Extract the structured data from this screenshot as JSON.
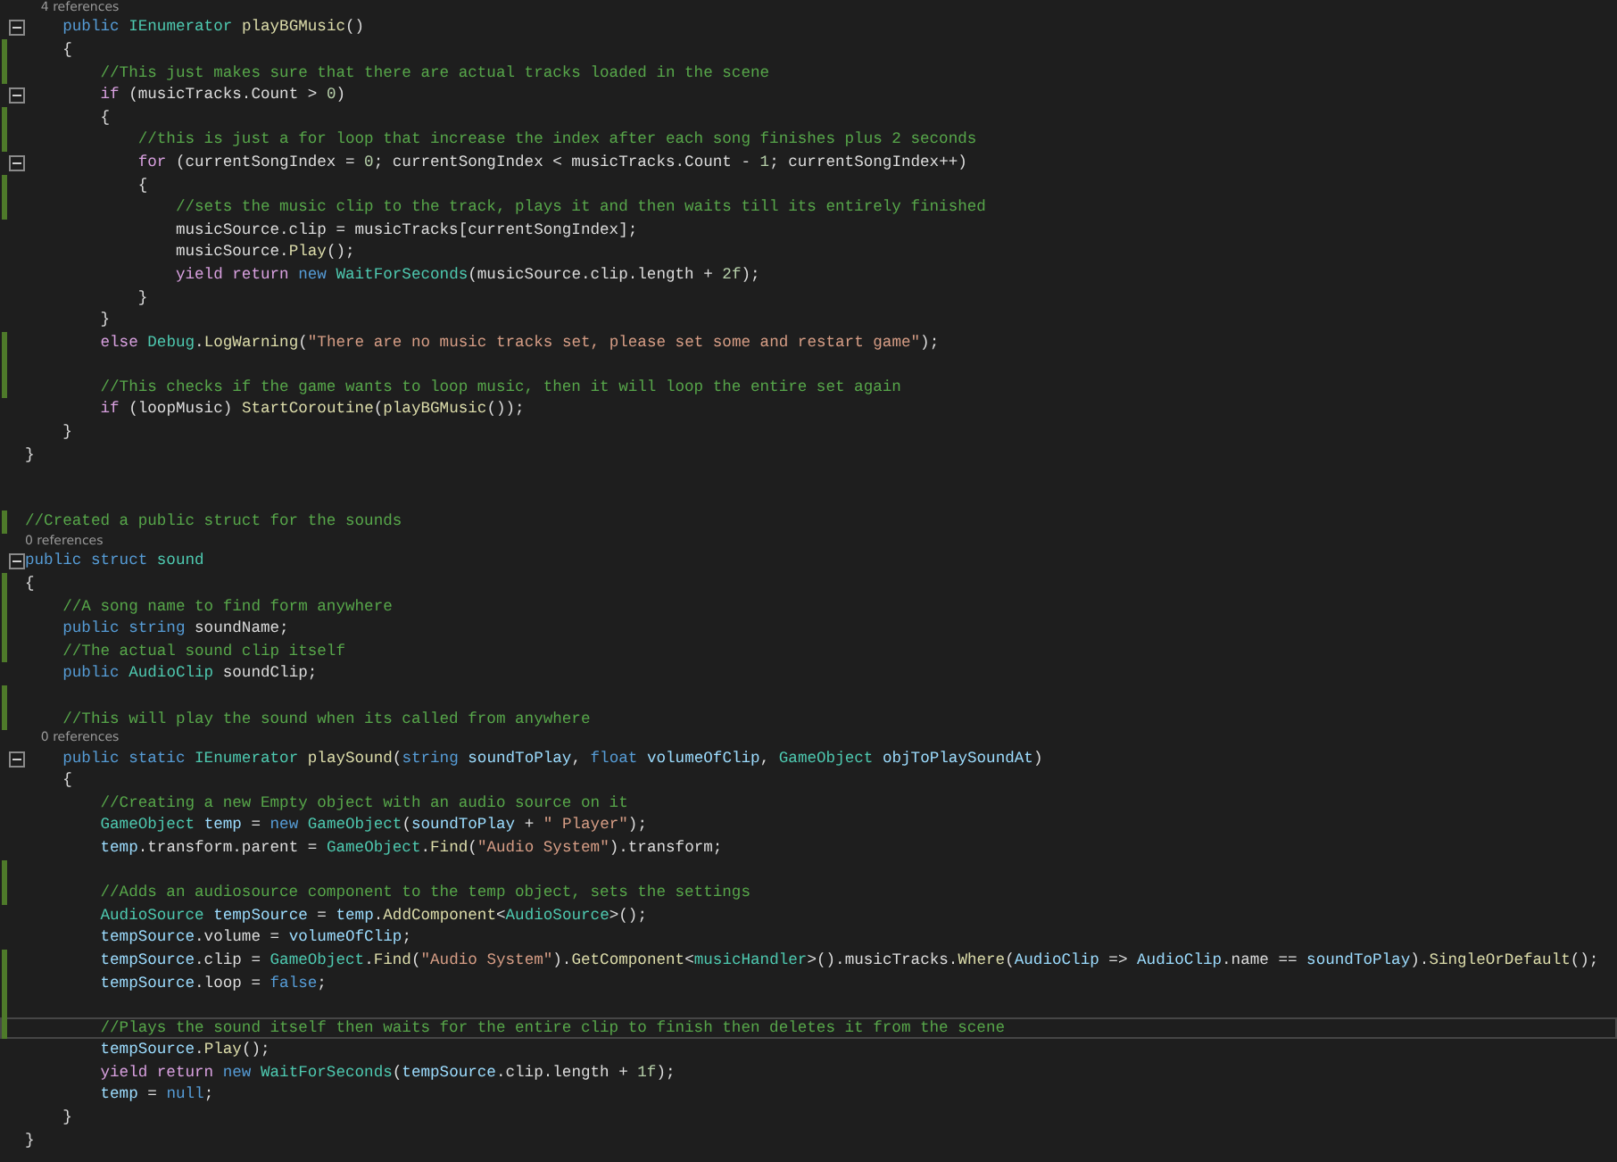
{
  "editor": {
    "lines": [
      {
        "kind": "lens",
        "text": "    4 references"
      },
      {
        "kind": "code",
        "changed": false,
        "fold": true,
        "current": false,
        "tokens": [
          {
            "kind": "kw",
            "text": "    public "
          },
          {
            "kind": "type",
            "text": "IEnumerator "
          },
          {
            "kind": "method",
            "text": "playBGMusic"
          },
          {
            "kind": "plain",
            "text": "()"
          }
        ]
      },
      {
        "kind": "code",
        "changed": true,
        "fold": false,
        "current": false,
        "tokens": [
          {
            "kind": "plain",
            "text": "    {"
          }
        ]
      },
      {
        "kind": "code",
        "changed": true,
        "fold": false,
        "current": false,
        "tokens": [
          {
            "kind": "comment",
            "text": "        //This just makes sure that there are actual tracks loaded in the scene"
          }
        ]
      },
      {
        "kind": "code",
        "changed": false,
        "fold": true,
        "current": false,
        "tokens": [
          {
            "kind": "ctrl",
            "text": "        if"
          },
          {
            "kind": "plain",
            "text": " (musicTracks.Count > "
          },
          {
            "kind": "num",
            "text": "0"
          },
          {
            "kind": "plain",
            "text": ")"
          }
        ]
      },
      {
        "kind": "code",
        "changed": true,
        "fold": false,
        "current": false,
        "tokens": [
          {
            "kind": "plain",
            "text": "        {"
          }
        ]
      },
      {
        "kind": "code",
        "changed": true,
        "fold": false,
        "current": false,
        "tokens": [
          {
            "kind": "comment",
            "text": "            //this is just a for loop that increase the index after each song finishes plus 2 seconds"
          }
        ]
      },
      {
        "kind": "code",
        "changed": false,
        "fold": true,
        "current": false,
        "tokens": [
          {
            "kind": "ctrl",
            "text": "            for"
          },
          {
            "kind": "plain",
            "text": " (currentSongIndex = "
          },
          {
            "kind": "num",
            "text": "0"
          },
          {
            "kind": "plain",
            "text": "; currentSongIndex < musicTracks.Count - "
          },
          {
            "kind": "num",
            "text": "1"
          },
          {
            "kind": "plain",
            "text": "; currentSongIndex++)"
          }
        ]
      },
      {
        "kind": "code",
        "changed": true,
        "fold": false,
        "current": false,
        "tokens": [
          {
            "kind": "plain",
            "text": "            {"
          }
        ]
      },
      {
        "kind": "code",
        "changed": true,
        "fold": false,
        "current": false,
        "tokens": [
          {
            "kind": "comment",
            "text": "                //sets the music clip to the track, plays it and then waits till its entirely finished"
          }
        ]
      },
      {
        "kind": "code",
        "changed": false,
        "fold": false,
        "current": false,
        "tokens": [
          {
            "kind": "plain",
            "text": "                musicSource.clip = musicTracks[currentSongIndex];"
          }
        ]
      },
      {
        "kind": "code",
        "changed": false,
        "fold": false,
        "current": false,
        "tokens": [
          {
            "kind": "plain",
            "text": "                musicSource."
          },
          {
            "kind": "method",
            "text": "Play"
          },
          {
            "kind": "plain",
            "text": "();"
          }
        ]
      },
      {
        "kind": "code",
        "changed": false,
        "fold": false,
        "current": false,
        "tokens": [
          {
            "kind": "ctrl",
            "text": "                yield return "
          },
          {
            "kind": "kw",
            "text": "new "
          },
          {
            "kind": "type",
            "text": "WaitForSeconds"
          },
          {
            "kind": "plain",
            "text": "(musicSource.clip.length + "
          },
          {
            "kind": "num",
            "text": "2f"
          },
          {
            "kind": "plain",
            "text": ");"
          }
        ]
      },
      {
        "kind": "code",
        "changed": false,
        "fold": false,
        "current": false,
        "tokens": [
          {
            "kind": "plain",
            "text": "            }"
          }
        ]
      },
      {
        "kind": "code",
        "changed": false,
        "fold": false,
        "current": false,
        "tokens": [
          {
            "kind": "plain",
            "text": "        }"
          }
        ]
      },
      {
        "kind": "code",
        "changed": true,
        "fold": false,
        "current": false,
        "tokens": [
          {
            "kind": "ctrl",
            "text": "        else "
          },
          {
            "kind": "type",
            "text": "Debug"
          },
          {
            "kind": "plain",
            "text": "."
          },
          {
            "kind": "method",
            "text": "LogWarning"
          },
          {
            "kind": "plain",
            "text": "("
          },
          {
            "kind": "string",
            "text": "\"There are no music tracks set, please set some and restart game\""
          },
          {
            "kind": "plain",
            "text": ");"
          }
        ]
      },
      {
        "kind": "code",
        "changed": true,
        "fold": false,
        "current": false
      },
      {
        "kind": "code",
        "changed": true,
        "fold": false,
        "current": false,
        "tokens": [
          {
            "kind": "comment",
            "text": "        //This checks if the game wants to loop music, then it will loop the entire set again"
          }
        ]
      },
      {
        "kind": "code",
        "changed": false,
        "fold": false,
        "current": false,
        "tokens": [
          {
            "kind": "ctrl",
            "text": "        if"
          },
          {
            "kind": "plain",
            "text": " (loopMusic) "
          },
          {
            "kind": "method",
            "text": "StartCoroutine"
          },
          {
            "kind": "plain",
            "text": "("
          },
          {
            "kind": "method",
            "text": "playBGMusic"
          },
          {
            "kind": "plain",
            "text": "());"
          }
        ]
      },
      {
        "kind": "code",
        "changed": false,
        "fold": false,
        "current": false,
        "tokens": [
          {
            "kind": "plain",
            "text": "    }"
          }
        ]
      },
      {
        "kind": "code",
        "changed": false,
        "fold": false,
        "current": false,
        "tokens": [
          {
            "kind": "plain",
            "text": "}"
          }
        ]
      },
      {
        "kind": "code",
        "changed": false,
        "fold": false,
        "current": false
      },
      {
        "kind": "code",
        "changed": false,
        "fold": false,
        "current": false
      },
      {
        "kind": "code",
        "changed": true,
        "fold": false,
        "current": false,
        "tokens": [
          {
            "kind": "comment",
            "text": "//Created a public struct for the sounds"
          }
        ]
      },
      {
        "kind": "lens",
        "text": "0 references"
      },
      {
        "kind": "code",
        "changed": false,
        "fold": true,
        "current": false,
        "tokens": [
          {
            "kind": "kw",
            "text": "public struct "
          },
          {
            "kind": "type",
            "text": "sound"
          }
        ]
      },
      {
        "kind": "code",
        "changed": true,
        "fold": false,
        "current": false,
        "tokens": [
          {
            "kind": "plain",
            "text": "{"
          }
        ]
      },
      {
        "kind": "code",
        "changed": true,
        "fold": false,
        "current": false,
        "tokens": [
          {
            "kind": "comment",
            "text": "    //A song name to find form anywhere"
          }
        ]
      },
      {
        "kind": "code",
        "changed": true,
        "fold": false,
        "current": false,
        "tokens": [
          {
            "kind": "kw",
            "text": "    public string "
          },
          {
            "kind": "plain",
            "text": "soundName;"
          }
        ]
      },
      {
        "kind": "code",
        "changed": true,
        "fold": false,
        "current": false,
        "tokens": [
          {
            "kind": "comment",
            "text": "    //The actual sound clip itself"
          }
        ]
      },
      {
        "kind": "code",
        "changed": false,
        "fold": false,
        "current": false,
        "tokens": [
          {
            "kind": "kw",
            "text": "    public "
          },
          {
            "kind": "type",
            "text": "AudioClip "
          },
          {
            "kind": "plain",
            "text": "soundClip;"
          }
        ]
      },
      {
        "kind": "code",
        "changed": true,
        "fold": false,
        "current": false
      },
      {
        "kind": "code",
        "changed": true,
        "fold": false,
        "current": false,
        "tokens": [
          {
            "kind": "comment",
            "text": "    //This will play the sound when its called from anywhere"
          }
        ]
      },
      {
        "kind": "lens",
        "text": "    0 references"
      },
      {
        "kind": "code",
        "changed": false,
        "fold": true,
        "current": false,
        "tokens": [
          {
            "kind": "kw",
            "text": "    public static "
          },
          {
            "kind": "type",
            "text": "IEnumerator "
          },
          {
            "kind": "method",
            "text": "playSound"
          },
          {
            "kind": "plain",
            "text": "("
          },
          {
            "kind": "kw",
            "text": "string "
          },
          {
            "kind": "var",
            "text": "soundToPlay"
          },
          {
            "kind": "plain",
            "text": ", "
          },
          {
            "kind": "kw",
            "text": "float "
          },
          {
            "kind": "var",
            "text": "volumeOfClip"
          },
          {
            "kind": "plain",
            "text": ", "
          },
          {
            "kind": "type",
            "text": "GameObject "
          },
          {
            "kind": "var",
            "text": "objToPlaySoundAt"
          },
          {
            "kind": "plain",
            "text": ")"
          }
        ]
      },
      {
        "kind": "code",
        "changed": false,
        "fold": false,
        "current": false,
        "tokens": [
          {
            "kind": "plain",
            "text": "    {"
          }
        ]
      },
      {
        "kind": "code",
        "changed": false,
        "fold": false,
        "current": false,
        "tokens": [
          {
            "kind": "comment",
            "text": "        //Creating a new Empty object with an audio source on it"
          }
        ]
      },
      {
        "kind": "code",
        "changed": false,
        "fold": false,
        "current": false,
        "tokens": [
          {
            "kind": "type",
            "text": "        GameObject "
          },
          {
            "kind": "var",
            "text": "temp"
          },
          {
            "kind": "plain",
            "text": " = "
          },
          {
            "kind": "kw",
            "text": "new "
          },
          {
            "kind": "type",
            "text": "GameObject"
          },
          {
            "kind": "plain",
            "text": "("
          },
          {
            "kind": "var",
            "text": "soundToPlay"
          },
          {
            "kind": "plain",
            "text": " + "
          },
          {
            "kind": "string",
            "text": "\" Player\""
          },
          {
            "kind": "plain",
            "text": ");"
          }
        ]
      },
      {
        "kind": "code",
        "changed": false,
        "fold": false,
        "current": false,
        "tokens": [
          {
            "kind": "var",
            "text": "        temp"
          },
          {
            "kind": "plain",
            "text": ".transform.parent = "
          },
          {
            "kind": "type",
            "text": "GameObject"
          },
          {
            "kind": "plain",
            "text": "."
          },
          {
            "kind": "method",
            "text": "Find"
          },
          {
            "kind": "plain",
            "text": "("
          },
          {
            "kind": "string",
            "text": "\"Audio System\""
          },
          {
            "kind": "plain",
            "text": ").transform;"
          }
        ]
      },
      {
        "kind": "code",
        "changed": true,
        "fold": false,
        "current": false
      },
      {
        "kind": "code",
        "changed": true,
        "fold": false,
        "current": false,
        "tokens": [
          {
            "kind": "comment",
            "text": "        //Adds an audiosource component to the temp object, sets the settings"
          }
        ]
      },
      {
        "kind": "code",
        "changed": false,
        "fold": false,
        "current": false,
        "tokens": [
          {
            "kind": "type",
            "text": "        AudioSource "
          },
          {
            "kind": "var",
            "text": "tempSource"
          },
          {
            "kind": "plain",
            "text": " = "
          },
          {
            "kind": "var",
            "text": "temp"
          },
          {
            "kind": "plain",
            "text": "."
          },
          {
            "kind": "method",
            "text": "AddComponent"
          },
          {
            "kind": "plain",
            "text": "<"
          },
          {
            "kind": "type",
            "text": "AudioSource"
          },
          {
            "kind": "plain",
            "text": ">();"
          }
        ]
      },
      {
        "kind": "code",
        "changed": false,
        "fold": false,
        "current": false,
        "tokens": [
          {
            "kind": "var",
            "text": "        tempSource"
          },
          {
            "kind": "plain",
            "text": ".volume = "
          },
          {
            "kind": "var",
            "text": "volumeOfClip"
          },
          {
            "kind": "plain",
            "text": ";"
          }
        ]
      },
      {
        "kind": "code",
        "changed": true,
        "fold": false,
        "current": false,
        "tokens": [
          {
            "kind": "var",
            "text": "        tempSource"
          },
          {
            "kind": "plain",
            "text": ".clip = "
          },
          {
            "kind": "type",
            "text": "GameObject"
          },
          {
            "kind": "plain",
            "text": "."
          },
          {
            "kind": "method",
            "text": "Find"
          },
          {
            "kind": "plain",
            "text": "("
          },
          {
            "kind": "string",
            "text": "\"Audio System\""
          },
          {
            "kind": "plain",
            "text": ")."
          },
          {
            "kind": "method",
            "text": "GetComponent"
          },
          {
            "kind": "plain",
            "text": "<"
          },
          {
            "kind": "type",
            "text": "musicHandler"
          },
          {
            "kind": "plain",
            "text": ">().musicTracks."
          },
          {
            "kind": "method",
            "text": "Where"
          },
          {
            "kind": "plain",
            "text": "("
          },
          {
            "kind": "var",
            "text": "AudioClip"
          },
          {
            "kind": "plain",
            "text": " => "
          },
          {
            "kind": "var",
            "text": "AudioClip"
          },
          {
            "kind": "plain",
            "text": ".name == "
          },
          {
            "kind": "var",
            "text": "soundToPlay"
          },
          {
            "kind": "plain",
            "text": ")."
          },
          {
            "kind": "method",
            "text": "SingleOrDefault"
          },
          {
            "kind": "plain",
            "text": "();"
          }
        ]
      },
      {
        "kind": "code",
        "changed": true,
        "fold": false,
        "current": false,
        "tokens": [
          {
            "kind": "var",
            "text": "        tempSource"
          },
          {
            "kind": "plain",
            "text": ".loop = "
          },
          {
            "kind": "kw",
            "text": "false"
          },
          {
            "kind": "plain",
            "text": ";"
          }
        ]
      },
      {
        "kind": "code",
        "changed": true,
        "fold": false,
        "current": false
      },
      {
        "kind": "code",
        "changed": true,
        "fold": false,
        "current": true,
        "tokens": [
          {
            "kind": "comment",
            "text": "        //Plays the sound itself then waits for the entire clip to finish then deletes it from the scene"
          }
        ]
      },
      {
        "kind": "code",
        "changed": false,
        "fold": false,
        "current": false,
        "tokens": [
          {
            "kind": "var",
            "text": "        tempSource"
          },
          {
            "kind": "plain",
            "text": "."
          },
          {
            "kind": "method",
            "text": "Play"
          },
          {
            "kind": "plain",
            "text": "();"
          }
        ]
      },
      {
        "kind": "code",
        "changed": false,
        "fold": false,
        "current": false,
        "tokens": [
          {
            "kind": "ctrl",
            "text": "        yield return "
          },
          {
            "kind": "kw",
            "text": "new "
          },
          {
            "kind": "type",
            "text": "WaitForSeconds"
          },
          {
            "kind": "plain",
            "text": "("
          },
          {
            "kind": "var",
            "text": "tempSource"
          },
          {
            "kind": "plain",
            "text": ".clip.length + "
          },
          {
            "kind": "num",
            "text": "1f"
          },
          {
            "kind": "plain",
            "text": ");"
          }
        ]
      },
      {
        "kind": "code",
        "changed": false,
        "fold": false,
        "current": false,
        "tokens": [
          {
            "kind": "var",
            "text": "        temp"
          },
          {
            "kind": "plain",
            "text": " = "
          },
          {
            "kind": "kw",
            "text": "null"
          },
          {
            "kind": "plain",
            "text": ";"
          }
        ]
      },
      {
        "kind": "code",
        "changed": false,
        "fold": false,
        "current": false,
        "tokens": [
          {
            "kind": "plain",
            "text": "    }"
          }
        ]
      },
      {
        "kind": "code",
        "changed": false,
        "fold": false,
        "current": false,
        "tokens": [
          {
            "kind": "plain",
            "text": "}"
          }
        ]
      }
    ]
  }
}
